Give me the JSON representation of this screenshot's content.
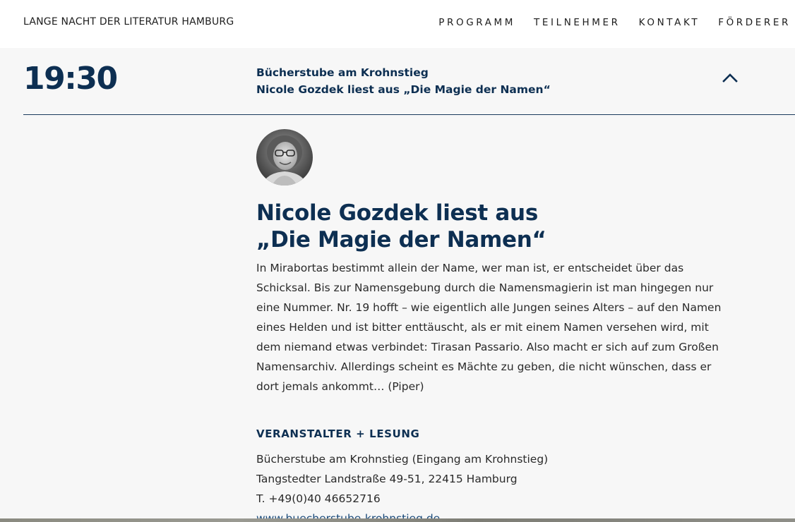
{
  "header": {
    "site_title": "LANGE NACHT DER LITERATUR HAMBURG",
    "nav": [
      "PROGRAMM",
      "TEILNEHMER",
      "KONTAKT",
      "FÖRDERER"
    ]
  },
  "event": {
    "time": "19:30",
    "summary_venue": "Bücherstube am Krohnstieg",
    "summary_reading": "Nicole Gozdek liest aus „Die Magie der Namen“",
    "title_line1": "Nicole Gozdek liest aus",
    "title_line2": "„Die Magie der Namen“",
    "description": "In Mirabortas bestimmt allein der Name, wer man ist, er entscheidet über das Schicksal. Bis zur Namensgebung durch die Namensmagierin ist man hingegen nur eine Nummer. Nr. 19 hofft – wie eigentlich alle Jungen seines Alters – auf den Namen eines Helden und ist bitter enttäuscht, als er mit einem Namen versehen wird, mit dem niemand etwas verbindet: Tirasan Passario. Also macht er sich auf zum Großen Namensarchiv. Allerdings scheint es Mächte zu geben, die nicht wünschen, dass er dort jemals ankommt… (Piper)",
    "organizer_heading": "VERANSTALTER + LESUNG",
    "venue_name": "Bücherstube am Krohnstieg (Eingang am Krohnstieg)",
    "venue_address": "Tangstedter Landstraße 49-51, 22415 Hamburg",
    "venue_phone": "T. +49(0)40 46652716",
    "venue_website": "www.buecherstube-krohnstieg.de"
  },
  "icons": {
    "collapse": "chevron-up-icon",
    "avatar": "author-avatar"
  },
  "colors": {
    "brand_navy": "#0d2f52",
    "background": "#f7f7f7"
  }
}
